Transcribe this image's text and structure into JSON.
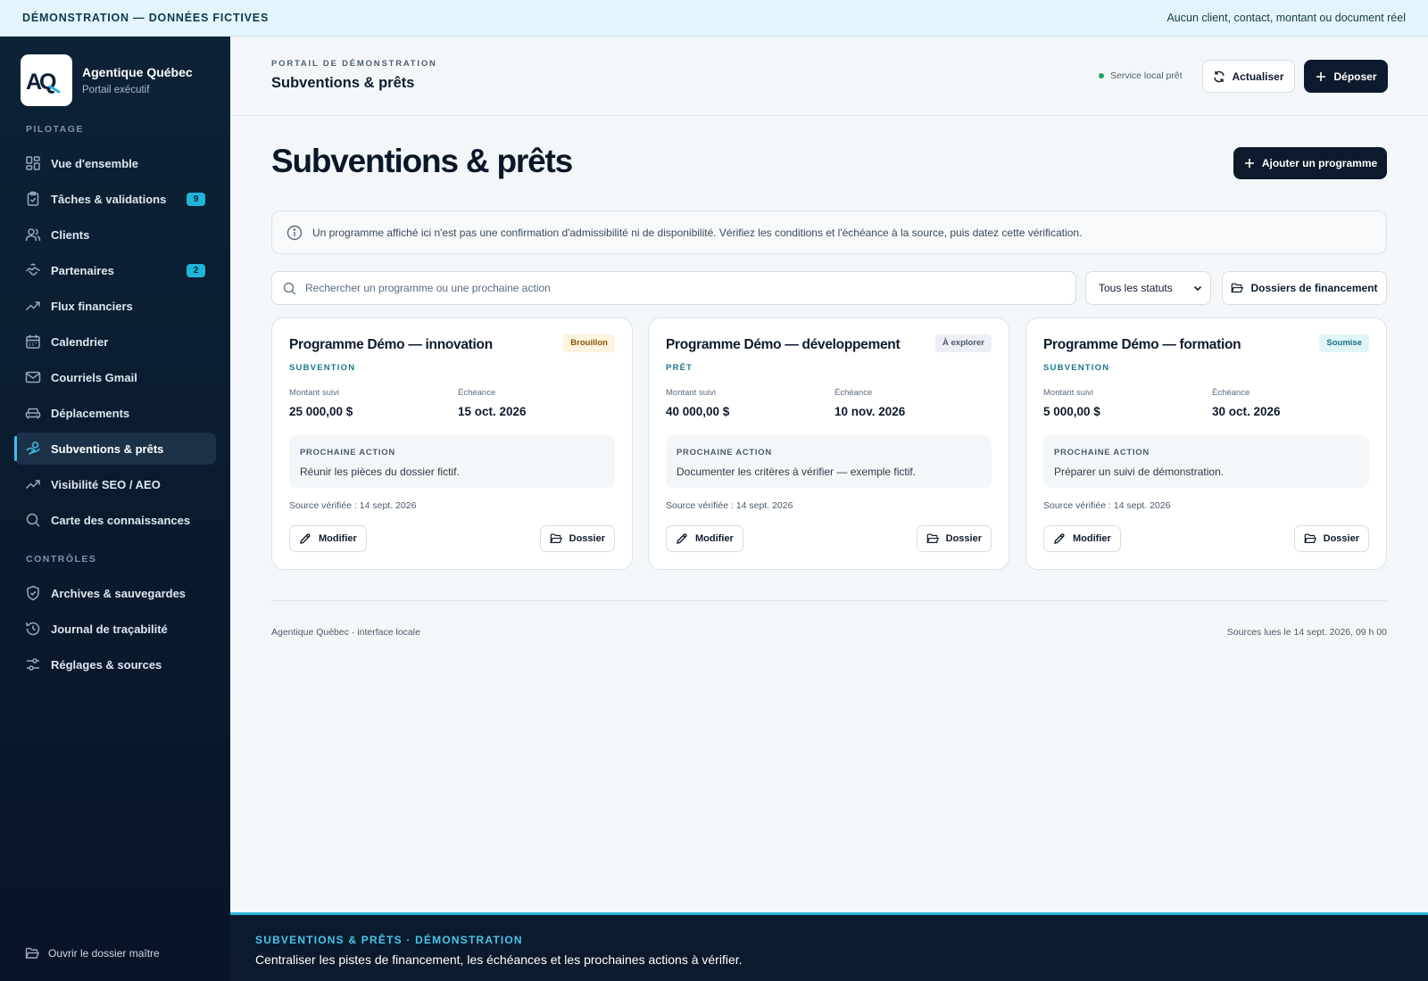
{
  "topbar": {
    "left": "DÉMONSTRATION — DONNÉES FICTIVES",
    "right": "Aucun client, contact, montant ou document réel"
  },
  "brand": {
    "logo_text": "AQ",
    "name": "Agentique Québec",
    "subtitle": "Portail exécutif"
  },
  "sidebar": {
    "section_pilotage": "PILOTAGE",
    "section_controles": "CONTRÔLES",
    "items": [
      {
        "label": "Vue d'ensemble",
        "icon": "grid-icon"
      },
      {
        "label": "Tâches & validations",
        "icon": "clipboard-check-icon",
        "badge": "9"
      },
      {
        "label": "Clients",
        "icon": "users-icon"
      },
      {
        "label": "Partenaires",
        "icon": "handshake-icon",
        "badge": "2"
      },
      {
        "label": "Flux financiers",
        "icon": "trending-up-icon"
      },
      {
        "label": "Calendrier",
        "icon": "calendar-icon"
      },
      {
        "label": "Courriels Gmail",
        "icon": "mail-icon"
      },
      {
        "label": "Déplacements",
        "icon": "car-icon"
      },
      {
        "label": "Subventions & prêts",
        "icon": "hand-coins-icon",
        "active": true
      },
      {
        "label": "Visibilité SEO / AEO",
        "icon": "trending-up-icon"
      },
      {
        "label": "Carte des connaissances",
        "icon": "search-icon"
      }
    ],
    "controls": [
      {
        "label": "Archives & sauvegardes",
        "icon": "shield-check-icon"
      },
      {
        "label": "Journal de traçabilité",
        "icon": "history-icon"
      },
      {
        "label": "Réglages & sources",
        "icon": "sliders-icon"
      }
    ],
    "footer": "Ouvrir le dossier maître"
  },
  "header": {
    "eyebrow": "PORTAIL DE DÉMONSTRATION",
    "title": "Subventions & prêts",
    "status": "Service local prêt",
    "refresh_label": "Actualiser",
    "deposit_label": "Déposer"
  },
  "main": {
    "title": "Subventions & prêts",
    "add_label": "Ajouter un programme",
    "notice": "Un programme affiché ici n'est pas une confirmation d'admissibilité ni de disponibilité. Vérifiez les conditions et l'échéance à la source, puis datez cette vérification.",
    "search_placeholder": "Rechercher un programme ou une prochaine action",
    "status_filter": "Tous les statuts",
    "folders_label": "Dossiers de financement"
  },
  "card_labels": {
    "amount": "Montant suivi",
    "deadline": "Échéance",
    "next_action": "PROCHAINE ACTION",
    "edit": "Modifier",
    "folder": "Dossier"
  },
  "programs": [
    {
      "title": "Programme Démo — innovation",
      "status": "Brouillon",
      "type": "SUBVENTION",
      "amount": "25 000,00 $",
      "deadline": "15 oct. 2026",
      "next_action": "Réunir les pièces du dossier fictif.",
      "source": "Source vérifiée : 14 sept. 2026"
    },
    {
      "title": "Programme Démo — développement",
      "status": "À explorer",
      "type": "PRÊT",
      "amount": "40 000,00 $",
      "deadline": "10 nov. 2026",
      "next_action": "Documenter les critères à vérifier — exemple fictif.",
      "source": "Source vérifiée : 14 sept. 2026"
    },
    {
      "title": "Programme Démo — formation",
      "status": "Soumise",
      "type": "SUBVENTION",
      "amount": "5 000,00 $",
      "deadline": "30 oct. 2026",
      "next_action": "Préparer un suivi de démonstration.",
      "source": "Source vérifiée : 14 sept. 2026"
    }
  ],
  "footer": {
    "left": "Agentique Québec · interface locale",
    "right": "Sources lues le 14 sept. 2026, 09 h 00"
  },
  "banner": {
    "eyebrow": "SUBVENTIONS & PRÊTS · DÉMONSTRATION",
    "text": "Centraliser les pistes de financement, les échéances et les prochaines actions à vérifier."
  },
  "colors": {
    "sidebar_bg": "#0d2237",
    "accent": "#29b6dd",
    "primary_button": "#0d1a2b",
    "status_ok": "#19a463"
  }
}
